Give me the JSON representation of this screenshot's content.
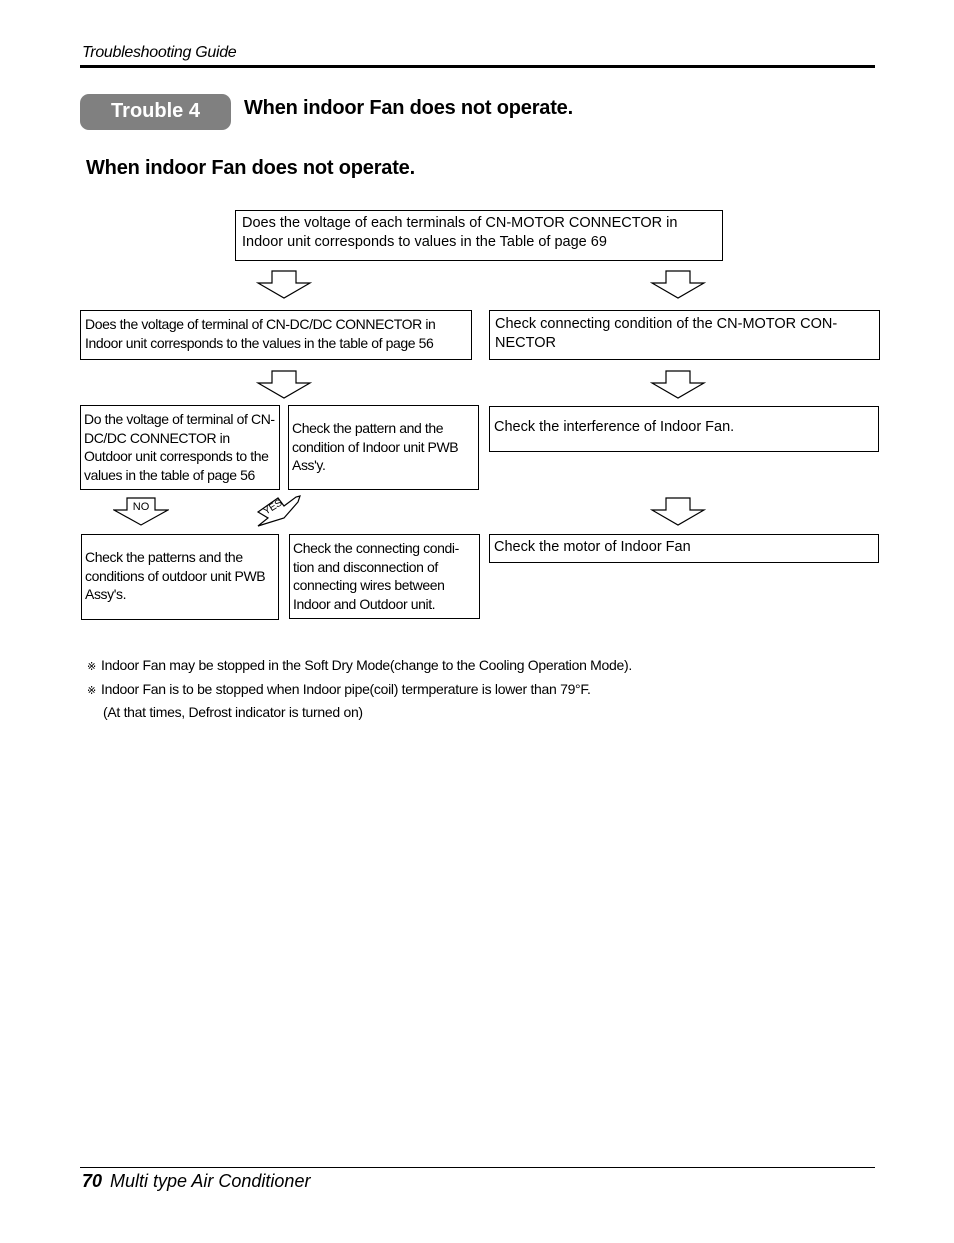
{
  "header": {
    "title": "Troubleshooting Guide"
  },
  "trouble": {
    "badge": "Trouble 4",
    "title": "When indoor Fan does not operate."
  },
  "section_title": "When indoor Fan does not operate.",
  "flowchart": {
    "start": "Does the voltage of each terminals of CN-MOTOR CONNECTOR in Indoor unit corresponds to values in the Table of page 69",
    "left_q1": "Does the voltage of terminal of CN-DC/DC CONNECTOR in Indoor unit corresponds to the values in the table of page 56",
    "right_1": "Check connecting condition of the CN-MOTOR CON-NECTOR",
    "left_q2": "Do the voltage of terminal of CN-DC/DC CONNECTOR in Outdoor unit corresponds to the values in the table of page 56",
    "mid_1": "Check the pattern and the condition of Indoor unit PWB Ass'y.",
    "right_2": "Check the interference of Indoor Fan.",
    "no_label": "NO",
    "yes_label": "YES",
    "left_result": "Check the patterns and the conditions of outdoor unit PWB Assy's.",
    "mid_result": "Check the connecting condi-tion and disconnection of connecting wires between Indoor and Outdoor unit.",
    "right_3": "Check the motor of Indoor Fan"
  },
  "notes": {
    "mark": "※",
    "items": [
      "Indoor Fan may be stopped in the Soft Dry Mode(change to the Cooling Operation Mode).",
      "Indoor Fan is to be stopped when Indoor pipe(coil) termperature is lower than 79°F."
    ],
    "continuation": "(At that times, Defrost indicator is turned on)"
  },
  "footer": {
    "page_number": "70",
    "title": "Multi type Air Conditioner"
  }
}
